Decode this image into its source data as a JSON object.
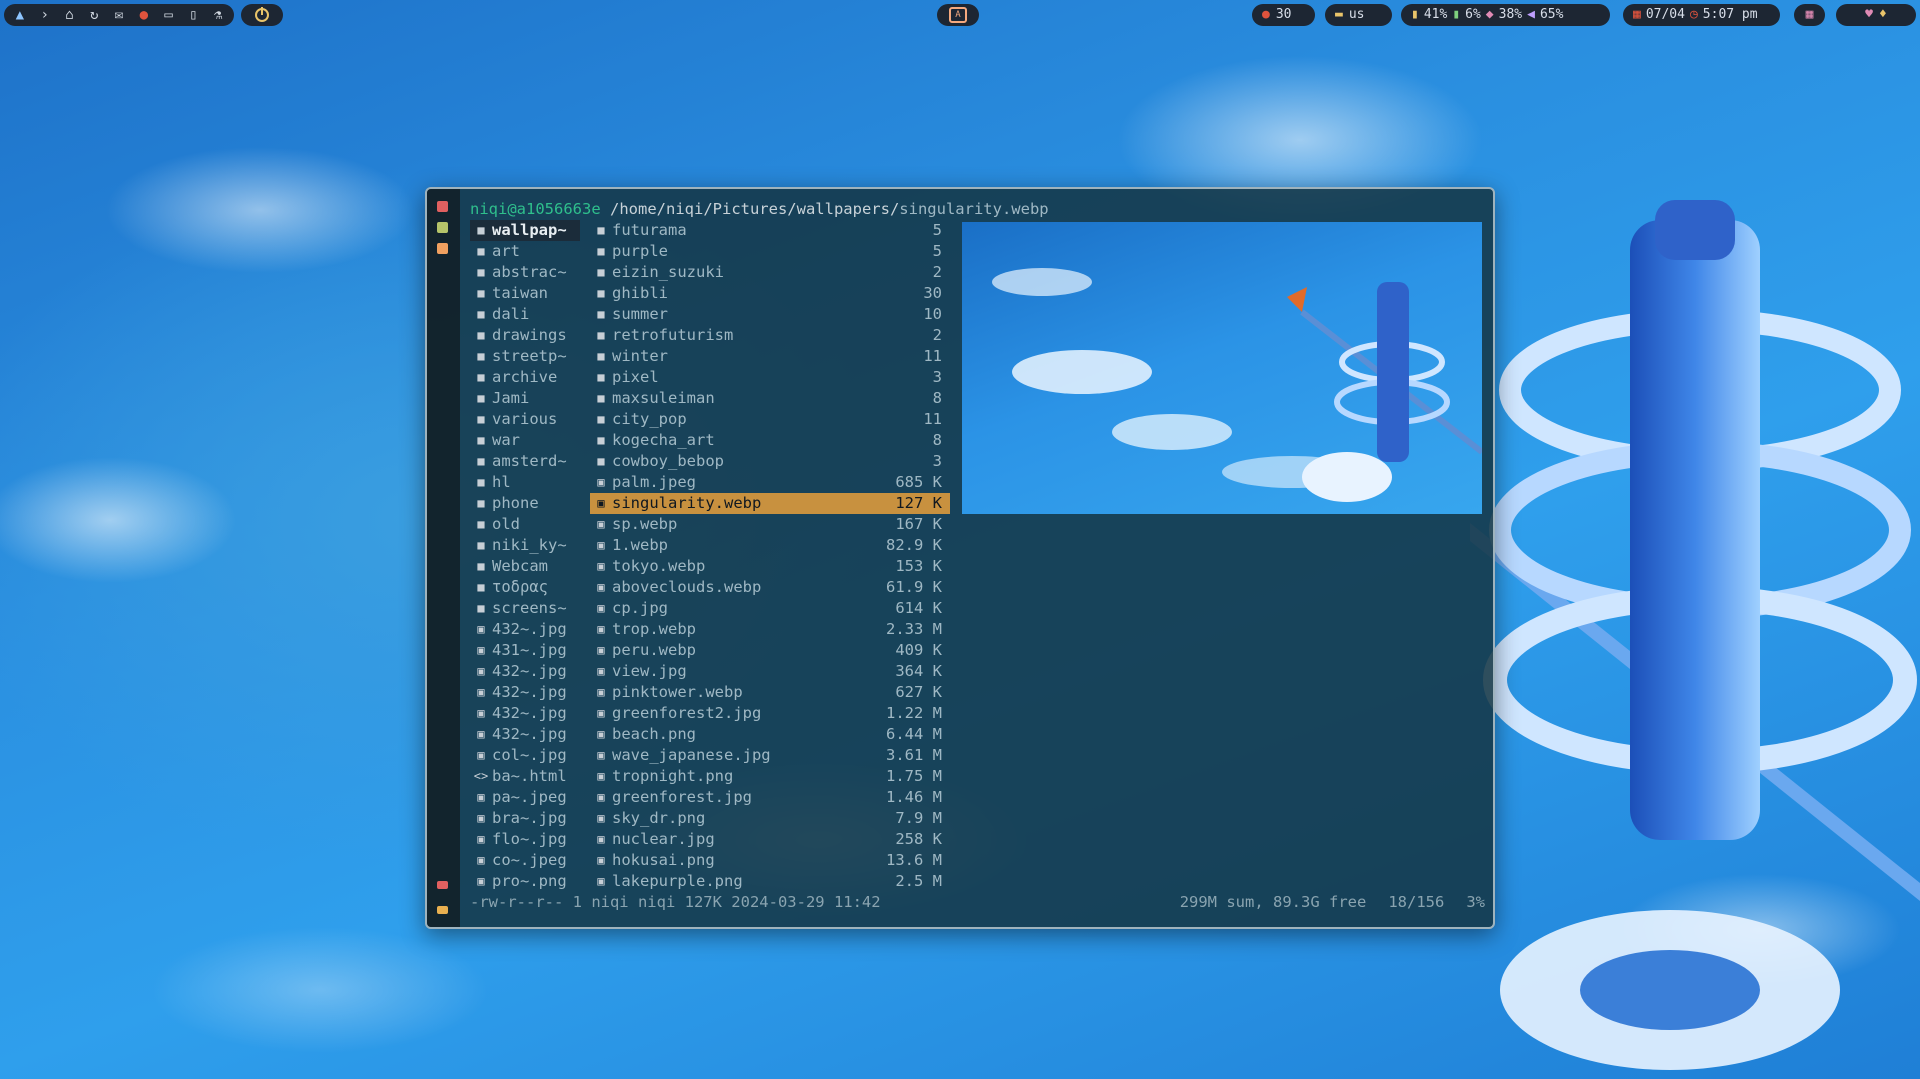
{
  "topbar": {
    "launcher_icons": [
      "arch-icon",
      "chevron-right-icon",
      "home-icon",
      "refresh-icon",
      "mail-icon",
      "chat-icon",
      "folder-icon",
      "book-icon",
      "flask-icon"
    ],
    "notifications": "30",
    "keyboard_layout": "us",
    "battery": "41%",
    "cpu": "6%",
    "memory": "38%",
    "volume": "65%",
    "date": "07/04",
    "time": "5:07 pm"
  },
  "terminal": {
    "user_host": "niqi@a1056663e",
    "path_dir": "/home/niqi/Pictures/wallpapers/",
    "path_file": "singularity.webp",
    "parent_entries": [
      {
        "name": "wallpap~",
        "type": "dir",
        "selected": true
      },
      {
        "name": "art",
        "type": "dir"
      },
      {
        "name": "abstrac~",
        "type": "dir"
      },
      {
        "name": "taiwan",
        "type": "dir"
      },
      {
        "name": "dali",
        "type": "dir"
      },
      {
        "name": "drawings",
        "type": "dir"
      },
      {
        "name": "streetp~",
        "type": "dir"
      },
      {
        "name": "archive",
        "type": "dir"
      },
      {
        "name": "Jami",
        "type": "dir"
      },
      {
        "name": "various",
        "type": "dir"
      },
      {
        "name": "war",
        "type": "dir"
      },
      {
        "name": "amsterd~",
        "type": "dir"
      },
      {
        "name": "hl",
        "type": "dir"
      },
      {
        "name": "phone",
        "type": "dir"
      },
      {
        "name": "old",
        "type": "dir"
      },
      {
        "name": "niki_ky~",
        "type": "dir"
      },
      {
        "name": "Webcam",
        "type": "dir"
      },
      {
        "name": "τοδρας",
        "type": "dir"
      },
      {
        "name": "screens~",
        "type": "dir"
      },
      {
        "name": "432~.jpg",
        "type": "img"
      },
      {
        "name": "431~.jpg",
        "type": "img"
      },
      {
        "name": "432~.jpg",
        "type": "img"
      },
      {
        "name": "432~.jpg",
        "type": "img"
      },
      {
        "name": "432~.jpg",
        "type": "img"
      },
      {
        "name": "432~.jpg",
        "type": "img"
      },
      {
        "name": "col~.jpg",
        "type": "img"
      },
      {
        "name": "ba~.html",
        "type": "code"
      },
      {
        "name": "pa~.jpeg",
        "type": "img"
      },
      {
        "name": "bra~.jpg",
        "type": "img"
      },
      {
        "name": "flo~.jpg",
        "type": "img"
      },
      {
        "name": "co~.jpeg",
        "type": "img"
      },
      {
        "name": "pro~.png",
        "type": "img"
      }
    ],
    "current_entries": [
      {
        "name": "futurama",
        "type": "dir",
        "size": "5"
      },
      {
        "name": "purple",
        "type": "dir",
        "size": "5"
      },
      {
        "name": "eizin_suzuki",
        "type": "dir",
        "size": "2"
      },
      {
        "name": "ghibli",
        "type": "dir",
        "size": "30"
      },
      {
        "name": "summer",
        "type": "dir",
        "size": "10"
      },
      {
        "name": "retrofuturism",
        "type": "dir",
        "size": "2"
      },
      {
        "name": "winter",
        "type": "dir",
        "size": "11"
      },
      {
        "name": "pixel",
        "type": "dir",
        "size": "3"
      },
      {
        "name": "maxsuleiman",
        "type": "dir",
        "size": "8"
      },
      {
        "name": "city_pop",
        "type": "dir",
        "size": "11"
      },
      {
        "name": "kogecha_art",
        "type": "dir",
        "size": "8"
      },
      {
        "name": "cowboy_bebop",
        "type": "dir",
        "size": "3"
      },
      {
        "name": "palm.jpeg",
        "type": "img",
        "size": "685 K"
      },
      {
        "name": "singularity.webp",
        "type": "img",
        "size": "127 K",
        "selected": true
      },
      {
        "name": "sp.webp",
        "type": "img",
        "size": "167 K"
      },
      {
        "name": "1.webp",
        "type": "img",
        "size": "82.9 K"
      },
      {
        "name": "tokyo.webp",
        "type": "img",
        "size": "153 K"
      },
      {
        "name": "aboveclouds.webp",
        "type": "img",
        "size": "61.9 K"
      },
      {
        "name": "cp.jpg",
        "type": "img",
        "size": "614 K"
      },
      {
        "name": "trop.webp",
        "type": "img",
        "size": "2.33 M"
      },
      {
        "name": "peru.webp",
        "type": "img",
        "size": "409 K"
      },
      {
        "name": "view.jpg",
        "type": "img",
        "size": "364 K"
      },
      {
        "name": "pinktower.webp",
        "type": "img",
        "size": "627 K"
      },
      {
        "name": "greenforest2.jpg",
        "type": "img",
        "size": "1.22 M"
      },
      {
        "name": "beach.png",
        "type": "img",
        "size": "6.44 M"
      },
      {
        "name": "wave_japanese.jpg",
        "type": "img",
        "size": "3.61 M"
      },
      {
        "name": "tropnight.png",
        "type": "img",
        "size": "1.75 M"
      },
      {
        "name": "greenforest.jpg",
        "type": "img",
        "size": "1.46 M"
      },
      {
        "name": "sky_dr.png",
        "type": "img",
        "size": "7.9 M"
      },
      {
        "name": "nuclear.jpg",
        "type": "img",
        "size": "258 K"
      },
      {
        "name": "hokusai.png",
        "type": "img",
        "size": "13.6 M"
      },
      {
        "name": "lakepurple.png",
        "type": "img",
        "size": "2.5 M"
      }
    ],
    "status_left": "-rw-r--r-- 1 niqi niqi 127K 2024-03-29 11:42",
    "status_sum": "299M sum, 89.3G free",
    "status_position": "18/156",
    "status_percent": "3%"
  },
  "colors": {
    "accent_selection": "#c8913f",
    "user_host": "#2fbf8c",
    "window_bg": "#143442"
  }
}
